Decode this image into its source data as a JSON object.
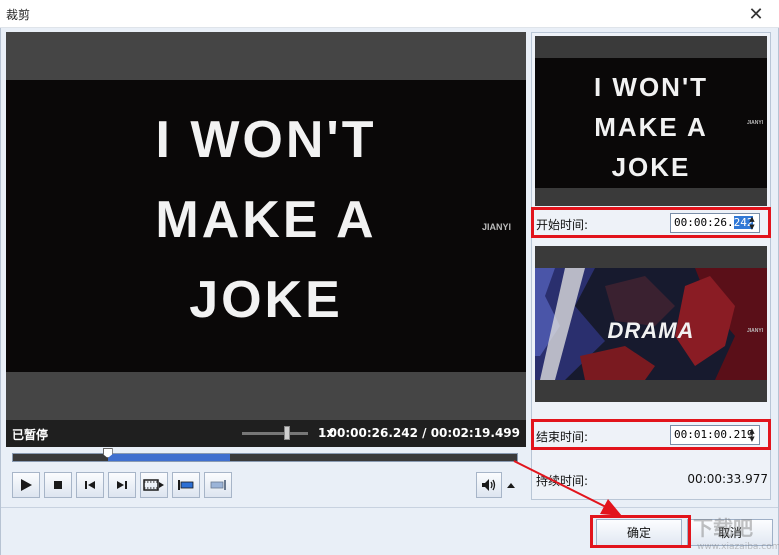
{
  "window": {
    "title": "裁剪",
    "close_glyph": "✕"
  },
  "main_video": {
    "lines": [
      "I WON'T",
      "MAKE A",
      "JOKE"
    ],
    "side_text": "JIANYI"
  },
  "status_bar": {
    "state": "已暂停",
    "speed": "1x",
    "time": "00:00:26.242 / 00:02:19.499"
  },
  "timeline": {
    "selection_start_fraction": 0.188,
    "selection_end_fraction": 0.43
  },
  "controls": {
    "buttons": [
      "play-icon",
      "stop-icon",
      "previous-frame-icon",
      "next-frame-icon",
      "filmstrip-icon",
      "set-start-icon",
      "set-end-icon"
    ],
    "volume_icon": "speaker-icon",
    "volume_menu_icon": "triangle-up-icon"
  },
  "start_preview": {
    "lines": [
      "I WON'T",
      "MAKE A",
      "JOKE"
    ],
    "side_text": "JIANYI"
  },
  "end_preview": {
    "text": "DRAMA",
    "side_text": "JIANYI"
  },
  "start_time": {
    "label": "开始时间:",
    "value_plain": "00:00:26.",
    "value_selected": "242"
  },
  "end_time": {
    "label": "结束时间:",
    "value": "00:01:00.219"
  },
  "duration": {
    "label": "持续时间:",
    "value": "00:00:33.977"
  },
  "buttons": {
    "ok": "确定",
    "cancel": "取消"
  },
  "watermark": {
    "big": "下载吧",
    "small": "www.xiazaiba.com"
  },
  "colors": {
    "highlight": "#e2141c",
    "selection": "#3f6fcf",
    "text_selection": "#3078d6"
  }
}
